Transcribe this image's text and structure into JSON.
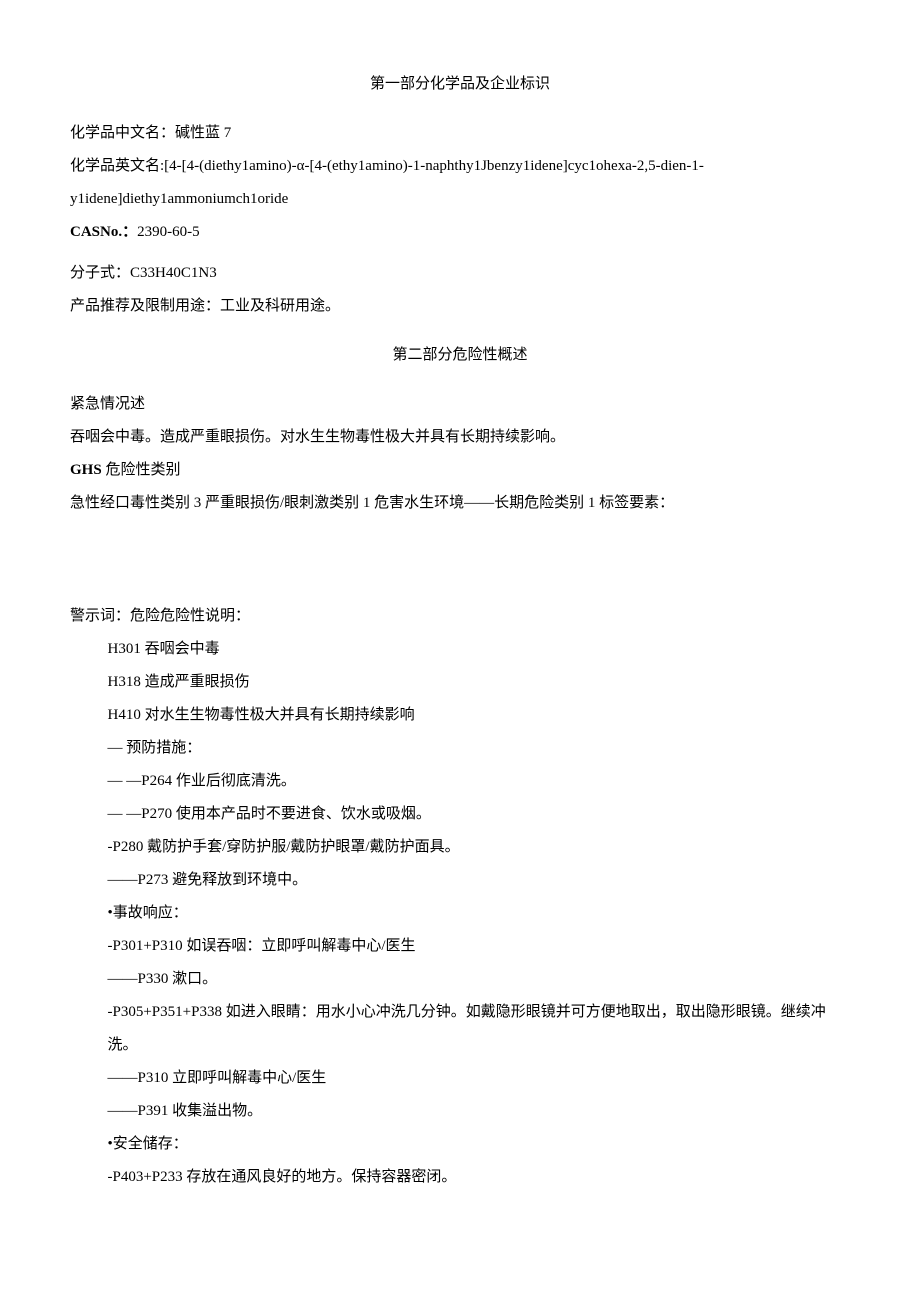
{
  "section1": {
    "title": "第一部分化学品及企业标识",
    "chineseName": {
      "label": "化学品中文名：",
      "value": "碱性蓝 7"
    },
    "englishName": {
      "label": "化学品英文名:",
      "value1": "[4-[4-(diethy1amino)-α-[4-(ethy1amino)-1-naphthy1Jbenzy1idene]cyc1ohexa-2,5-dien-1-",
      "value2": "y1idene]diethy1ammoniumch1oride"
    },
    "casNo": {
      "label": "CASNo.：",
      "value": "2390-60-5"
    },
    "formula": {
      "label": "分子式：",
      "value": "C33H40C1N3"
    },
    "usage": {
      "label": "产品推荐及限制用途：",
      "value": "工业及科研用途。"
    }
  },
  "section2": {
    "title": "第二部分危险性概述",
    "emergencyTitle": "紧急情况述",
    "emergencyDesc": "吞咽会中毒。造成严重眼损伤。对水生生物毒性极大并具有长期持续影响。",
    "ghsTitle": "GHS 危险性类别",
    "ghsDesc": "急性经口毒性类别 3 严重眼损伤/眼刺激类别 1 危害水生环境——长期危险类别 1 标签要素：",
    "signalWord": "警示词：危险危险性说明：",
    "hazards": [
      "H301 吞咽会中毒",
      "H318 造成严重眼损伤",
      "H410 对水生生物毒性极大并具有长期持续影响"
    ],
    "preventionTitle": "— 预防措施：",
    "preventions": [
      "—   —P264 作业后彻底清洗。",
      "—           —P270 使用本产品时不要进食、饮水或吸烟。",
      "-P280 戴防护手套/穿防护服/戴防护眼罩/戴防护面具。",
      "——P273 避免释放到环境中。"
    ],
    "responseTitle": "•事故响应：",
    "responses": [
      "-P301+P310 如误吞咽：立即呼叫解毒中心/医生",
      "——P330 漱口。",
      "-P305+P351+P338 如进入眼睛：用水小心冲洗几分钟。如戴隐形眼镜并可方便地取出，取出隐形眼镜。继续冲洗。",
      "——P310 立即呼叫解毒中心/医生",
      "——P391 收集溢出物。"
    ],
    "storageTitle": "•安全储存：",
    "storage": [
      "-P403+P233 存放在通风良好的地方。保持容器密闭。"
    ]
  }
}
